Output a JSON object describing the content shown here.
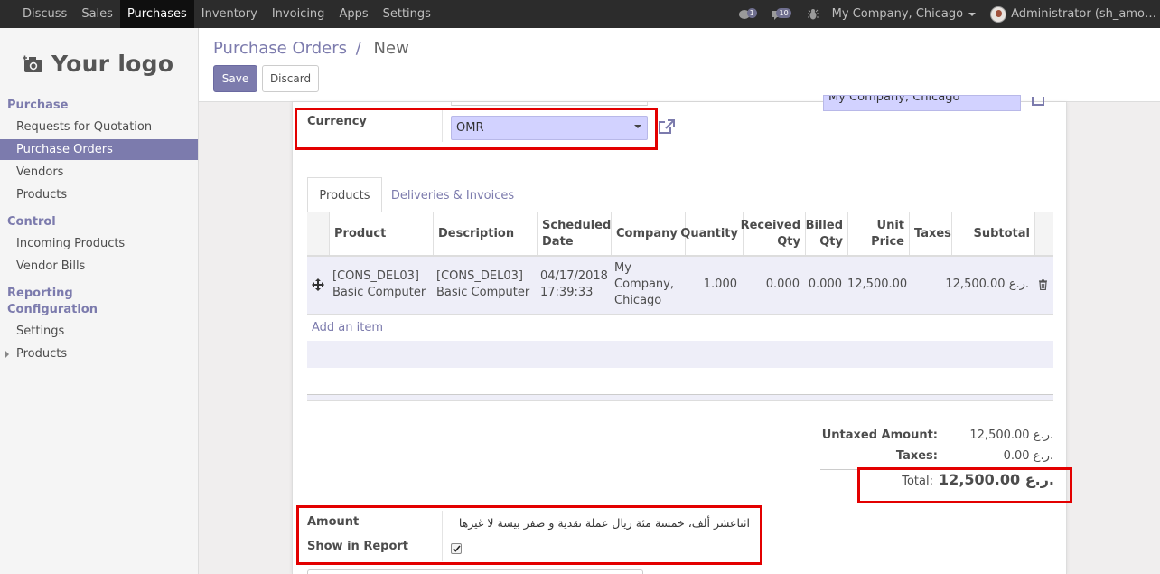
{
  "topbar": {
    "menu": [
      "Discuss",
      "Sales",
      "Purchases",
      "Inventory",
      "Invoicing",
      "Apps",
      "Settings"
    ],
    "active_menu": "Purchases",
    "chat_badge": "1",
    "activity_badge": "10",
    "company": "My Company, Chicago",
    "user": "Administrator (sh_amo…"
  },
  "sidebar": {
    "logo_text": "Your logo",
    "purchase_header": "Purchase",
    "purchase_items": [
      "Requests for Quotation",
      "Purchase Orders",
      "Vendors",
      "Products"
    ],
    "control_header": "Control",
    "control_items": [
      "Incoming Products",
      "Vendor Bills"
    ],
    "reporting_header": "Reporting",
    "configuration_header": "Configuration",
    "config_items": [
      "Settings",
      "Products"
    ]
  },
  "breadcrumb": {
    "parent": "Purchase Orders",
    "separator": "/",
    "current": "New"
  },
  "buttons": {
    "save": "Save",
    "discard": "Discard"
  },
  "form": {
    "company_partial": "My Company, Chicago",
    "currency_label": "Currency",
    "currency_value": "OMR",
    "tabs": [
      "Products",
      "Deliveries & Invoices"
    ],
    "columns": [
      "Product",
      "Description",
      "Scheduled Date",
      "Company",
      "Quantity",
      "Received Qty",
      "Billed Qty",
      "Unit Price",
      "Taxes",
      "Subtotal"
    ],
    "line": {
      "product": "[CONS_DEL03] Basic Computer",
      "description": "[CONS_DEL03] Basic Computer",
      "scheduled_date": "04/17/2018 17:39:33",
      "company": "My Company, Chicago",
      "quantity": "1.000",
      "received_qty": "0.000",
      "billed_qty": "0.000",
      "unit_price": "12,500.00",
      "taxes": "",
      "subtotal": "12,500.00 ر.ع."
    },
    "add_item": "Add an item",
    "untaxed_label": "Untaxed Amount:",
    "untaxed_value": "12,500.00 ر.ع.",
    "taxes_label": "Taxes:",
    "taxes_value": "0.00 ر.ع.",
    "total_label": "Total:",
    "total_value": "12,500.00 ر.ع.",
    "amount_label": "Amount",
    "amount_value": "اثناعشر ألف، خمسة مئة ريال عملة نقدية و صفر بيسة لا غيرها",
    "show_in_report_label": "Show in Report",
    "show_in_report_checked": true
  },
  "colors": {
    "accent": "#7c7bad",
    "highlight": "#e30000",
    "selectbg": "#d2d2ff"
  }
}
